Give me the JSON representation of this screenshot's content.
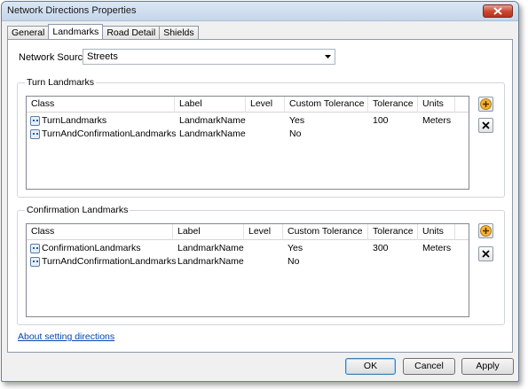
{
  "window": {
    "title": "Network Directions Properties"
  },
  "tabs": [
    {
      "label": "General"
    },
    {
      "label": "Landmarks"
    },
    {
      "label": "Road Detail"
    },
    {
      "label": "Shields"
    }
  ],
  "network_source": {
    "label": "Network Source:",
    "value": "Streets"
  },
  "turn_landmarks": {
    "title": "Turn Landmarks",
    "columns": [
      "Class",
      "Label",
      "Level",
      "Custom Tolerance",
      "Tolerance",
      "Units"
    ],
    "rows": [
      {
        "class": "TurnLandmarks",
        "label": "LandmarkName",
        "level": "",
        "custom_tolerance": "Yes",
        "tolerance": "100",
        "units": "Meters"
      },
      {
        "class": "TurnAndConfirmationLandmarks",
        "label": "LandmarkName",
        "level": "",
        "custom_tolerance": "No",
        "tolerance": "",
        "units": ""
      }
    ]
  },
  "confirmation_landmarks": {
    "title": "Confirmation Landmarks",
    "columns": [
      "Class",
      "Label",
      "Level",
      "Custom Tolerance",
      "Tolerance",
      "Units"
    ],
    "rows": [
      {
        "class": "ConfirmationLandmarks",
        "label": "LandmarkName",
        "level": "",
        "custom_tolerance": "Yes",
        "tolerance": "300",
        "units": "Meters"
      },
      {
        "class": "TurnAndConfirmationLandmarks",
        "label": "LandmarkName",
        "level": "",
        "custom_tolerance": "No",
        "tolerance": "",
        "units": ""
      }
    ]
  },
  "help_link": "About setting directions",
  "buttons": {
    "ok": "OK",
    "cancel": "Cancel",
    "apply": "Apply"
  }
}
